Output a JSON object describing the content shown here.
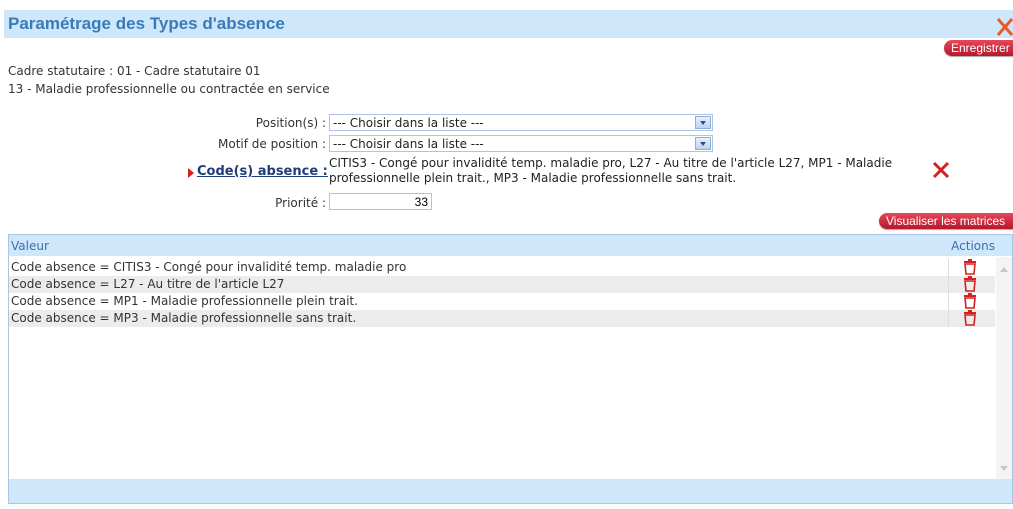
{
  "header": {
    "title": "Paramétrage des Types d'absence"
  },
  "toolbar": {
    "save_label": "Enregistrer"
  },
  "info": {
    "cadre": "Cadre statutaire : 01 - Cadre statutaire 01",
    "motif": "13 - Maladie professionnelle ou contractée en service"
  },
  "form": {
    "position_label": "Position(s) :",
    "position_value": "--- Choisir dans la liste ---",
    "motif_label": "Motif de position :",
    "motif_value": "--- Choisir dans la liste ---",
    "codes_label": "Code(s) absence :",
    "codes_value": "CITIS3 - Congé pour invalidité temp. maladie pro, L27 - Au titre de l'article L27, MP1 - Maladie professionnelle plein trait., MP3 - Maladie professionnelle sans trait.",
    "priorite_label": "Priorité :",
    "priorite_value": "33"
  },
  "matrices_label": "Visualiser les matrices",
  "grid": {
    "headers": {
      "valeur": "Valeur",
      "actions": "Actions"
    },
    "rows": [
      {
        "valeur": "Code absence = CITIS3 - Congé pour invalidité temp. maladie pro"
      },
      {
        "valeur": "Code absence = L27 - Au titre de l'article L27"
      },
      {
        "valeur": "Code absence = MP1 - Maladie professionnelle plein trait."
      },
      {
        "valeur": "Code absence = MP3 - Maladie professionnelle sans trait."
      }
    ]
  },
  "colors": {
    "accent": "#3a7ab8",
    "header_bg": "#cfe7fa",
    "button_red": "#c8192e"
  },
  "icons": {
    "close": "close-icon",
    "remove": "remove-icon",
    "delete": "trash-icon",
    "arrow": "marker-arrow-icon"
  }
}
